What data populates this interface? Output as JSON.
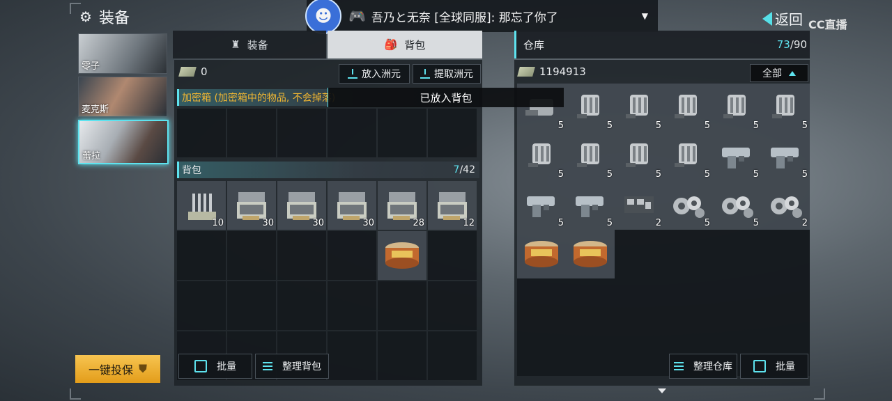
{
  "header": {
    "title": "装备",
    "back_label": "返回",
    "watermark": "CC直播"
  },
  "stream_bar": {
    "text": "吾乃と无奈 [全球同服]: 那忘了你了"
  },
  "characters": [
    {
      "name": "零子",
      "selected": false
    },
    {
      "name": "麦克斯",
      "selected": false
    },
    {
      "name": "蕾拉",
      "selected": true
    }
  ],
  "insure_button": "一键投保",
  "tabs": [
    {
      "label": "装备",
      "active": false
    },
    {
      "label": "背包",
      "active": true
    }
  ],
  "left": {
    "money": "0",
    "deposit_label": "放入洲元",
    "withdraw_label": "提取洲元",
    "secure_box_label": "加密箱 (加密箱中的物品, 不会掉落)",
    "backpack_label": "背包",
    "backpack_count": "7",
    "backpack_capacity": "/42",
    "toast": "已放入背包",
    "batch_label": "批量",
    "sort_label": "整理背包",
    "items": [
      {
        "icon": "ammo-rounds-icon",
        "count": "10"
      },
      {
        "icon": "ammo-box-icon",
        "count": "30"
      },
      {
        "icon": "ammo-box-icon",
        "count": "30"
      },
      {
        "icon": "ammo-box-icon",
        "count": "30"
      },
      {
        "icon": "ammo-box-icon",
        "count": "28"
      },
      {
        "icon": "ammo-box-icon",
        "count": "12"
      },
      {
        "icon": "canned-food-icon",
        "count": ""
      }
    ]
  },
  "right": {
    "title": "仓库",
    "count": "73",
    "capacity": "/90",
    "money": "1194913",
    "filter_label": "全部",
    "sort_label": "整理仓库",
    "batch_label": "批量",
    "items": [
      {
        "icon": "part-icon",
        "count": "5"
      },
      {
        "icon": "gun-part-icon",
        "count": "5"
      },
      {
        "icon": "gun-part-icon",
        "count": "5"
      },
      {
        "icon": "gun-part-icon",
        "count": "5"
      },
      {
        "icon": "gun-part-icon",
        "count": "5"
      },
      {
        "icon": "gun-part-icon",
        "count": "5"
      },
      {
        "icon": "gun-part-icon",
        "count": "5"
      },
      {
        "icon": "gun-part-icon",
        "count": "5"
      },
      {
        "icon": "gun-part-icon",
        "count": "5"
      },
      {
        "icon": "gun-part-icon",
        "count": "5"
      },
      {
        "icon": "pistol-part-icon",
        "count": "5"
      },
      {
        "icon": "pistol-part-icon",
        "count": "5"
      },
      {
        "icon": "pistol-part-icon",
        "count": "5"
      },
      {
        "icon": "pistol-part-icon",
        "count": "5"
      },
      {
        "icon": "circuit-icon",
        "count": "2"
      },
      {
        "icon": "gears-icon",
        "count": "5"
      },
      {
        "icon": "gears-icon",
        "count": "5"
      },
      {
        "icon": "gears-icon",
        "count": "2"
      },
      {
        "icon": "canned-food-icon",
        "count": ""
      },
      {
        "icon": "canned-food-icon",
        "count": ""
      }
    ]
  }
}
